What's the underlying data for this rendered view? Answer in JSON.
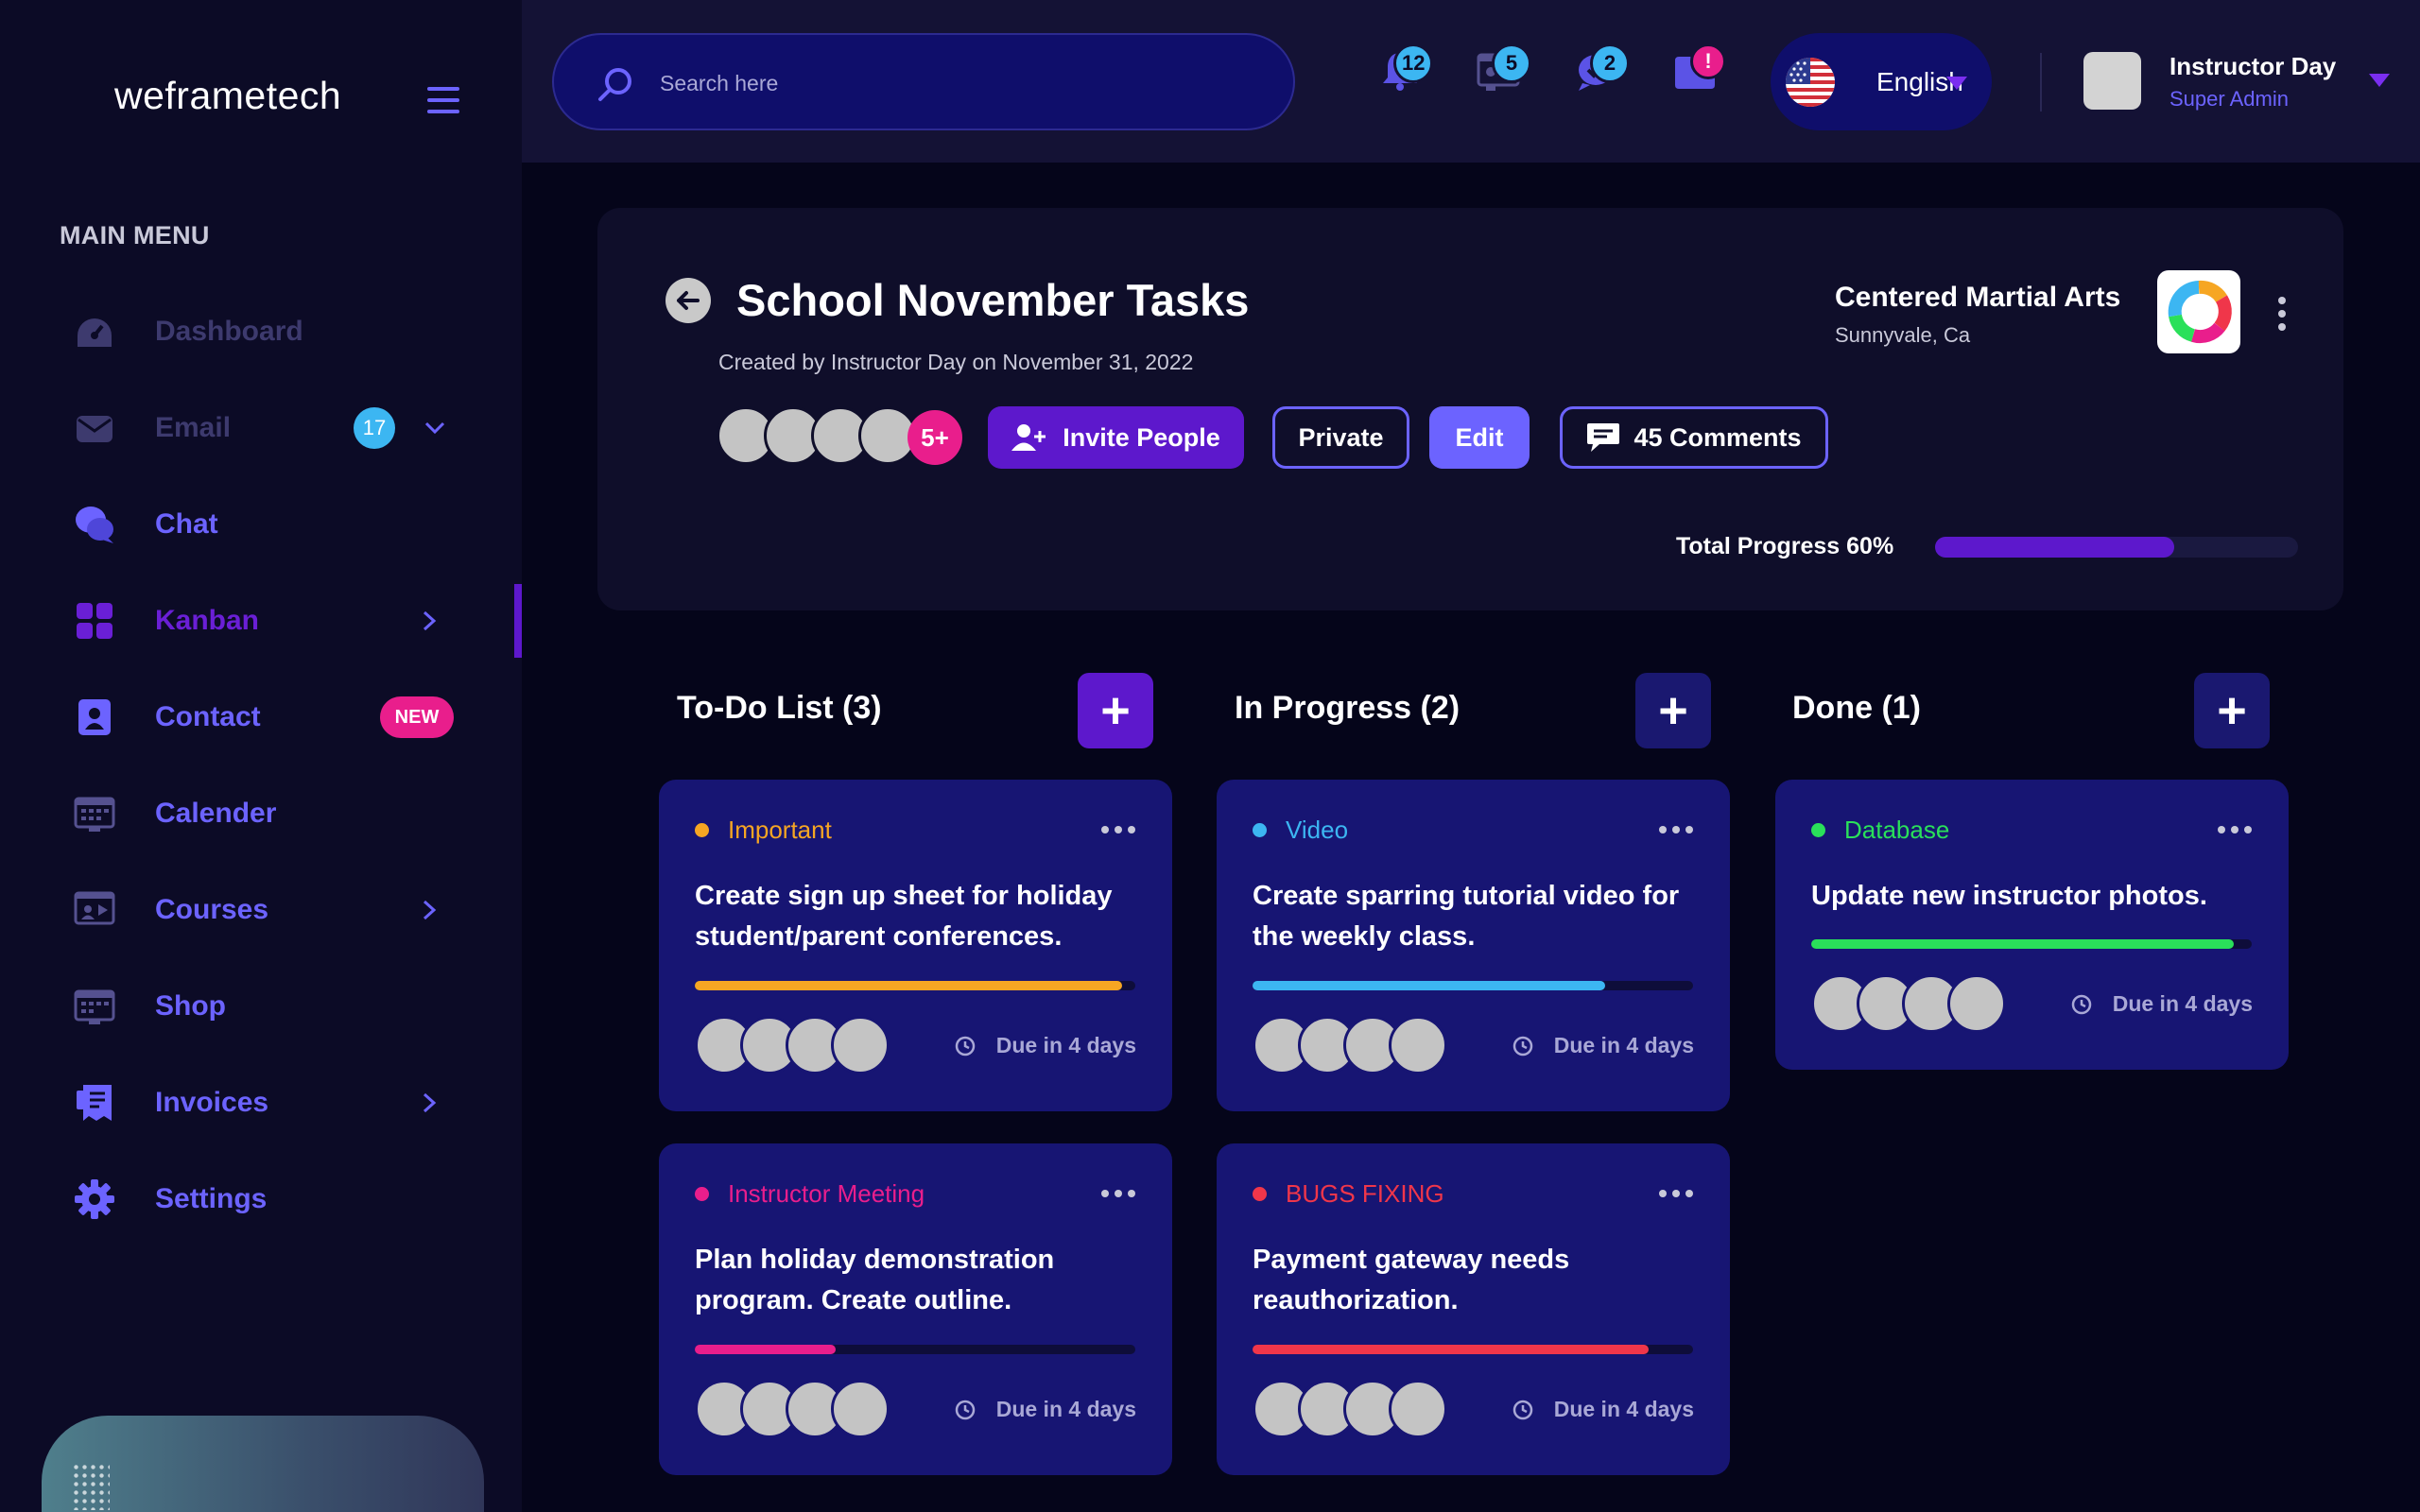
{
  "brand": "weframetech",
  "menu_title": "MAIN MENU",
  "nav": [
    {
      "label": "Dashboard",
      "icon": "dashboard-icon",
      "state": "dim"
    },
    {
      "label": "Email",
      "icon": "mail-icon",
      "state": "dim",
      "badge": "17"
    },
    {
      "label": "Chat",
      "icon": "chat-icon",
      "state": "normal"
    },
    {
      "label": "Kanban",
      "icon": "kanban-icon",
      "state": "active"
    },
    {
      "label": "Contact",
      "icon": "contact-icon",
      "state": "normal",
      "tag": "NEW"
    },
    {
      "label": "Calender",
      "icon": "calendar-icon",
      "state": "normal"
    },
    {
      "label": "Courses",
      "icon": "courses-icon",
      "state": "normal"
    },
    {
      "label": "Shop",
      "icon": "shop-icon",
      "state": "normal"
    },
    {
      "label": "Invoices",
      "icon": "invoices-icon",
      "state": "normal"
    },
    {
      "label": "Settings",
      "icon": "gear-icon",
      "state": "normal"
    }
  ],
  "header": {
    "search_placeholder": "Search here",
    "notifications": [
      {
        "icon": "bell-icon",
        "count": "12"
      },
      {
        "icon": "certificate-icon",
        "count": "5"
      },
      {
        "icon": "chat-check-icon",
        "count": "2"
      },
      {
        "icon": "folder-icon",
        "count": "!"
      }
    ],
    "language": "English",
    "user": {
      "name": "Instructor Day",
      "role": "Super Admin"
    }
  },
  "project": {
    "title": "School November Tasks",
    "created_by": "Created by Instructor Day on November 31, 2022",
    "members_more": "5+",
    "invite_label": "Invite People",
    "private_label": "Private",
    "edit_label": "Edit",
    "comments_label": "45 Comments",
    "org_name": "Centered Martial Arts",
    "org_location": "Sunnyvale, Ca",
    "progress_label": "Total Progress 60%",
    "progress_fraction": 0.66
  },
  "columns": [
    {
      "title": "To-Do List (3)",
      "add": "+"
    },
    {
      "title": "In Progress (2)",
      "add": "+"
    },
    {
      "title": "Done (1)",
      "add": "+"
    }
  ],
  "cards": [
    {
      "tag": "Important",
      "color": "#f6a623",
      "title": "Create sign up sheet for holiday student/parent conferences.",
      "progress": 0.97,
      "due": "Due in 4 days"
    },
    {
      "tag": "Instructor Meeting",
      "color": "#e91e8c",
      "title": "Plan holiday demonstration program. Create outline.",
      "progress": 0.32,
      "due": "Due in 4 days"
    },
    {
      "tag": "Video",
      "color": "#3cb6f2",
      "title": "Create sparring tutorial video for the weekly class.",
      "progress": 0.8,
      "due": "Due in 4 days"
    },
    {
      "tag": "BUGS FIXING",
      "color": "#f0364a",
      "title": "Payment gateway needs reauthorization.",
      "progress": 0.9,
      "due": "Due in 4 days"
    },
    {
      "tag": "Database",
      "color": "#2ae05a",
      "title": "Update new instructor photos.",
      "progress": 0.96,
      "due": "Due in 4 days"
    }
  ]
}
